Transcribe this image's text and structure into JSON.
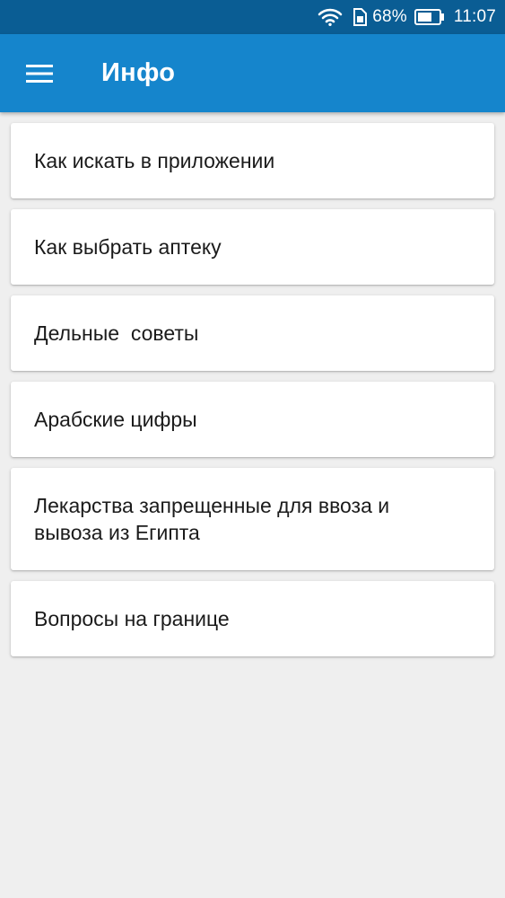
{
  "status_bar": {
    "battery_percent": "68%",
    "time": "11:07",
    "icons": [
      "wifi-icon",
      "sim-icon",
      "battery-icon"
    ],
    "battery_level": 0.68
  },
  "app_bar": {
    "menu_icon": "hamburger-menu-icon",
    "title": "Инфо",
    "color": "#1585cc",
    "status_color": "#0a5d94"
  },
  "items": [
    {
      "label": "Как искать в приложении"
    },
    {
      "label": "Как выбрать аптеку"
    },
    {
      "label": "Дельные  советы"
    },
    {
      "label": "Арабские цифры"
    },
    {
      "label": "Лекарства запрещенные для ввоза и\nвывоза из Египта"
    },
    {
      "label": "Вопросы на границе"
    }
  ]
}
